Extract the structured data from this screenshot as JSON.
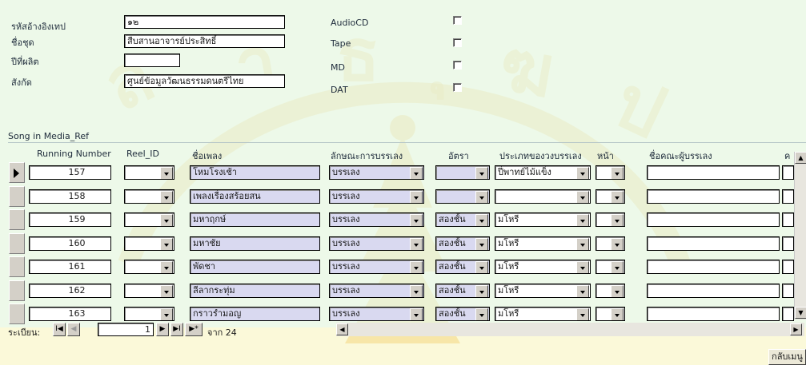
{
  "form": {
    "fields": [
      {
        "label": "รหัสอ้างอิงเทป",
        "value": "๑๒"
      },
      {
        "label": "ชื่อชุด",
        "value": "สืบสานอาจารย์ประสิทธิ์"
      },
      {
        "label": "ปีที่ผลิต",
        "value": ""
      },
      {
        "label": "สังกัด",
        "value": "ศูนย์ข้อมูลวัฒนธรรมดนตรีไทย"
      }
    ],
    "media": [
      {
        "label": "AudioCD",
        "checked": false
      },
      {
        "label": "Tape",
        "checked": false
      },
      {
        "label": "MD",
        "checked": false
      },
      {
        "label": "DAT",
        "checked": false
      }
    ]
  },
  "subform": {
    "title": "Song in Media_Ref",
    "columns": [
      "Running Number",
      "Reel_ID",
      "ชื่อเพลง",
      "ลักษณะการบรรเลง",
      "อัตรา",
      "ประเภทของวงบรรเลง",
      "หน้า",
      "ชื่อคณะผู้บรรเลง",
      "ค"
    ],
    "rows": [
      {
        "running": "157",
        "reel": "",
        "song": "โหมโรงเช้า",
        "style": "บรรเลง",
        "rate": "",
        "band": "ปี่พาทย์ไม้แข็ง",
        "side": ""
      },
      {
        "running": "158",
        "reel": "",
        "song": "เพลงเรื่องสร้อยสน",
        "style": "บรรเลง",
        "rate": "",
        "band": "",
        "side": ""
      },
      {
        "running": "159",
        "reel": "",
        "song": "มหาฤกษ์",
        "style": "บรรเลง",
        "rate": "สองชั้น",
        "band": "มโหรี",
        "side": ""
      },
      {
        "running": "160",
        "reel": "",
        "song": "มหาชัย",
        "style": "บรรเลง",
        "rate": "สองชั้น",
        "band": "มโหรี",
        "side": ""
      },
      {
        "running": "161",
        "reel": "",
        "song": "พัดชา",
        "style": "บรรเลง",
        "rate": "สองชั้น",
        "band": "มโหรี",
        "side": ""
      },
      {
        "running": "162",
        "reel": "",
        "song": "ลีลากระทุ่ม",
        "style": "บรรเลง",
        "rate": "สองชั้น",
        "band": "มโหรี",
        "side": ""
      },
      {
        "running": "163",
        "reel": "",
        "song": "กราวรำมอญ",
        "style": "บรรเลง",
        "rate": "สองชั้น",
        "band": "มโหรี",
        "side": ""
      }
    ]
  },
  "nav": {
    "label": "ระเบียน:",
    "current": "1",
    "of_text": "จาก 24",
    "first": "I◀",
    "prev": "◀",
    "next": "▶",
    "last": "▶I",
    "new": "▶*"
  },
  "menu_button": "กลับเมนู",
  "colors": {
    "background": "#fbf9d9",
    "lavender_field": "#d9d9f0",
    "watermark": "#f2d36b"
  }
}
